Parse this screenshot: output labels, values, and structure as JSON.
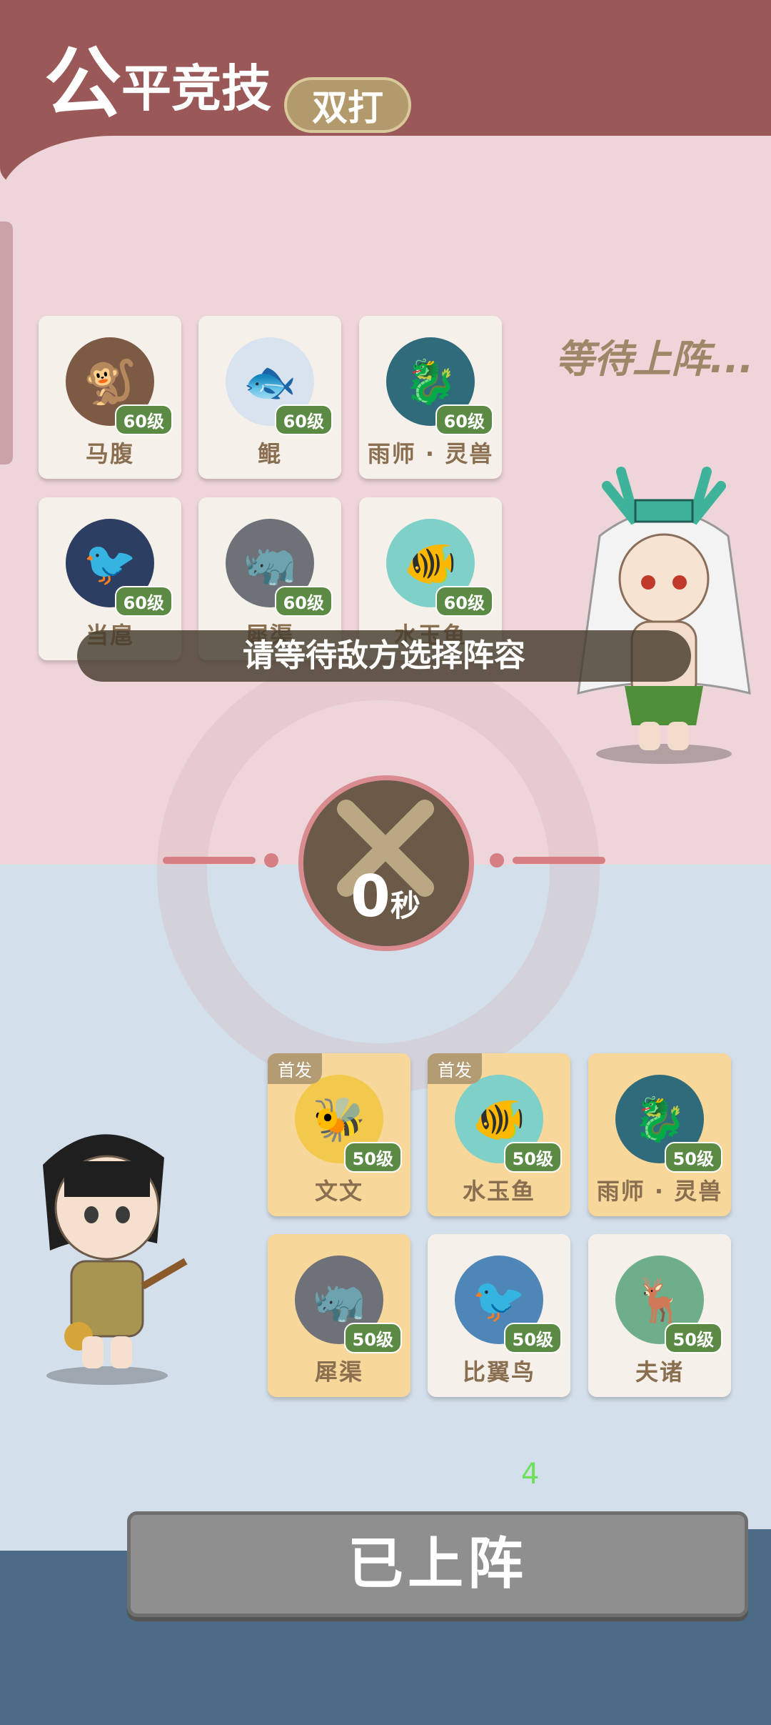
{
  "header": {
    "title_main": "公",
    "title_rest": "平竞技",
    "mode": "双打"
  },
  "enemy": {
    "status": "等待上阵...",
    "pets": [
      {
        "name": "马腹",
        "level": "60级",
        "color": "#7d5a44",
        "glyph": "🐒"
      },
      {
        "name": "鲲",
        "level": "60级",
        "color": "#d9e3ef",
        "glyph": "🐟"
      },
      {
        "name": "雨师 · 灵兽",
        "level": "60级",
        "color": "#2f6b7a",
        "glyph": "🐉"
      },
      {
        "name": "当扈",
        "level": "60级",
        "color": "#2c3f63",
        "glyph": "🐦"
      },
      {
        "name": "犀渠",
        "level": "60级",
        "color": "#6e7278",
        "glyph": "🦏"
      },
      {
        "name": "水玉鱼",
        "level": "60级",
        "color": "#7ed0c8",
        "glyph": "🐠"
      }
    ]
  },
  "notice": "请等待敌方选择阵容",
  "timer": {
    "value": "0",
    "unit": "秒"
  },
  "player": {
    "pets": [
      {
        "name": "文文",
        "level": "50级",
        "color": "#f2c94c",
        "glyph": "🐝",
        "starter": "首发",
        "gold": true
      },
      {
        "name": "水玉鱼",
        "level": "50级",
        "color": "#7ed0c8",
        "glyph": "🐠",
        "starter": "首发",
        "gold": true
      },
      {
        "name": "雨师 · 灵兽",
        "level": "50级",
        "color": "#2f6b7a",
        "glyph": "🐉",
        "starter": "",
        "gold": true
      },
      {
        "name": "犀渠",
        "level": "50级",
        "color": "#6e7278",
        "glyph": "🦏",
        "starter": "",
        "gold": true
      },
      {
        "name": "比翼鸟",
        "level": "50级",
        "color": "#4f86b8",
        "glyph": "🐦",
        "starter": "",
        "gold": false
      },
      {
        "name": "夫诸",
        "level": "50级",
        "color": "#6fae8a",
        "glyph": "🦌",
        "starter": "",
        "gold": false
      }
    ]
  },
  "counter": "4",
  "ready_button": "已上阵"
}
